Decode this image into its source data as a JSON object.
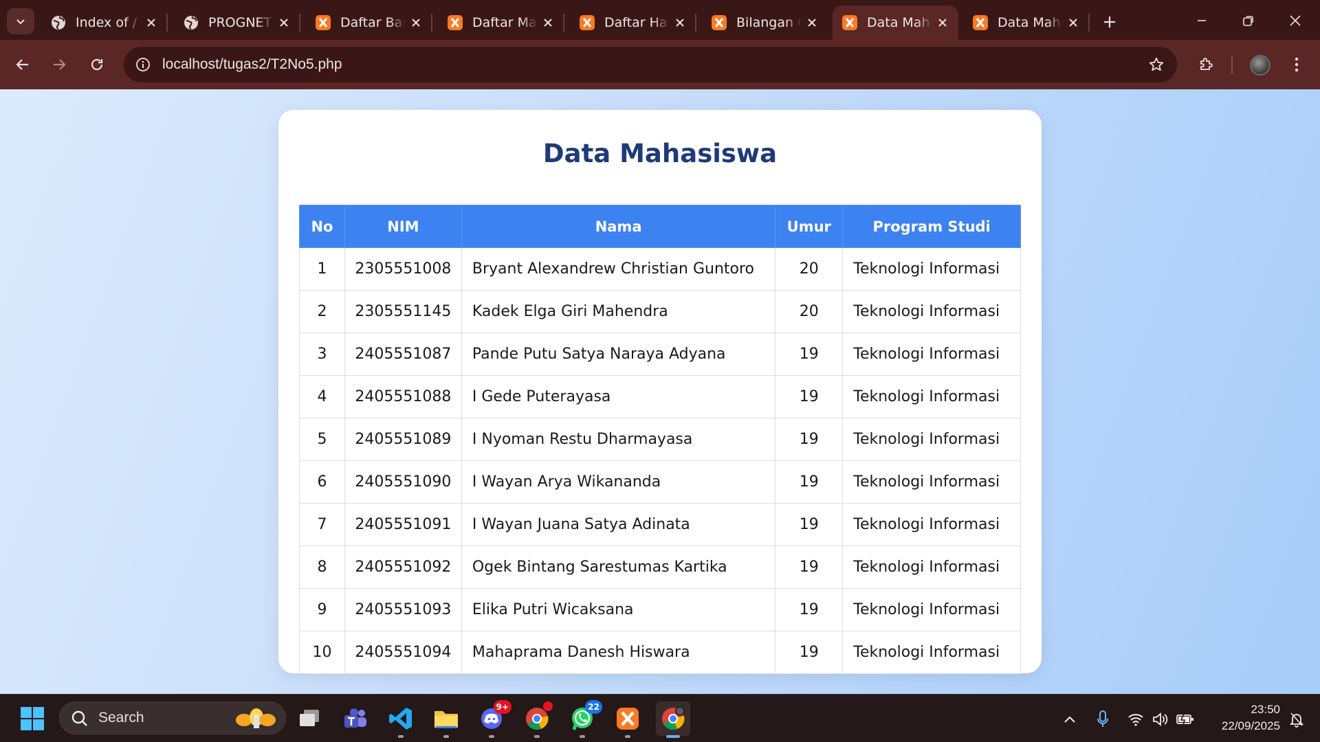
{
  "browser": {
    "tabs": [
      {
        "title": "Index of /",
        "icon": "globe-icon"
      },
      {
        "title": "PROGNET",
        "icon": "globe-icon"
      },
      {
        "title": "Daftar Barang",
        "icon": "xampp-icon"
      },
      {
        "title": "Daftar Mahasiswa",
        "icon": "xampp-icon"
      },
      {
        "title": "Daftar Harga",
        "icon": "xampp-icon"
      },
      {
        "title": "Bilangan Genap",
        "icon": "xampp-icon"
      },
      {
        "title": "Data Mahasiswa",
        "icon": "xampp-icon",
        "active": true
      },
      {
        "title": "Data Mahasiswa",
        "icon": "xampp-icon"
      }
    ],
    "url": "localhost/tugas2/T2No5.php"
  },
  "page": {
    "title": "Data Mahasiswa",
    "table": {
      "headers": [
        "No",
        "NIM",
        "Nama",
        "Umur",
        "Program Studi"
      ],
      "rows": [
        [
          "1",
          "2305551008",
          "Bryant Alexandrew Christian Guntoro",
          "20",
          "Teknologi Informasi"
        ],
        [
          "2",
          "2305551145",
          "Kadek Elga Giri Mahendra",
          "20",
          "Teknologi Informasi"
        ],
        [
          "3",
          "2405551087",
          "Pande Putu Satya Naraya Adyana",
          "19",
          "Teknologi Informasi"
        ],
        [
          "4",
          "2405551088",
          "I Gede Puterayasa",
          "19",
          "Teknologi Informasi"
        ],
        [
          "5",
          "2405551089",
          "I Nyoman Restu Dharmayasa",
          "19",
          "Teknologi Informasi"
        ],
        [
          "6",
          "2405551090",
          "I Wayan Arya Wikananda",
          "19",
          "Teknologi Informasi"
        ],
        [
          "7",
          "2405551091",
          "I Wayan Juana Satya Adinata",
          "19",
          "Teknologi Informasi"
        ],
        [
          "8",
          "2405551092",
          "Ogek Bintang Sarestumas Kartika",
          "19",
          "Teknologi Informasi"
        ],
        [
          "9",
          "2405551093",
          "Elika Putri Wicaksana",
          "19",
          "Teknologi Informasi"
        ],
        [
          "10",
          "2405551094",
          "Mahaprama Danesh Hiswara",
          "19",
          "Teknologi Informasi"
        ]
      ]
    }
  },
  "taskbar": {
    "search_label": "Search",
    "discord_badge": "9+",
    "whatsapp_badge": "22",
    "time": "23:50",
    "date": "22/09/2025"
  },
  "colors": {
    "tab_bg": "#3a1717",
    "toolbar_bg": "#5a2626",
    "header_blue": "#3c82f0",
    "title_navy": "#1f3a7a"
  }
}
